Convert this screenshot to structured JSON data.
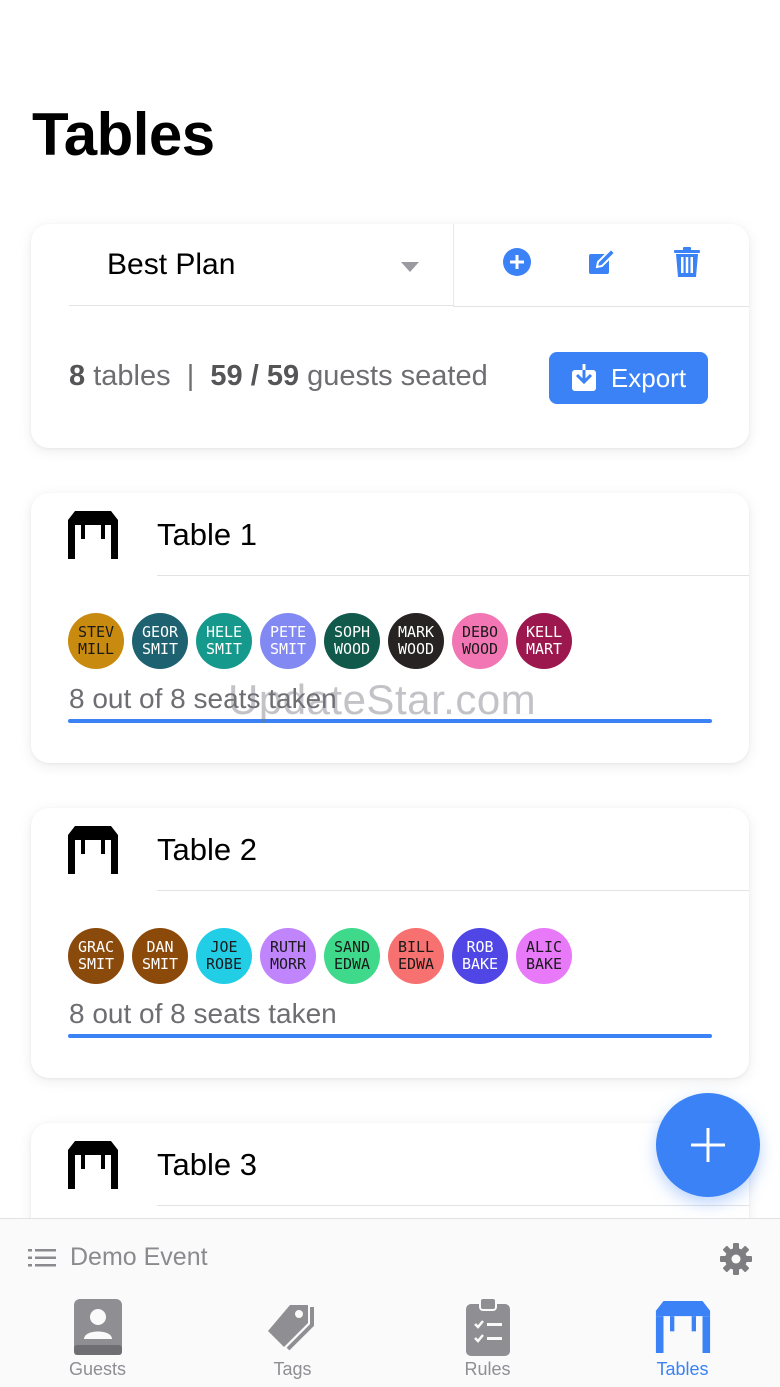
{
  "page": {
    "title": "Tables"
  },
  "plan": {
    "name": "Best Plan",
    "table_count": "8",
    "tables_label": "tables",
    "separator": "|",
    "guests_seated": "59 / 59",
    "guests_label": "guests seated",
    "export_label": "Export"
  },
  "tables": [
    {
      "name": "Table 1",
      "seats_text": "8 out of 8 seats taken",
      "progress": 1.0,
      "guests": [
        {
          "line1": "STEV",
          "line2": "MILL",
          "color": "#c98a10",
          "text": "dark"
        },
        {
          "line1": "GEOR",
          "line2": "SMIT",
          "color": "#1e6272",
          "text": "light"
        },
        {
          "line1": "HELE",
          "line2": "SMIT",
          "color": "#14998c",
          "text": "light"
        },
        {
          "line1": "PETE",
          "line2": "SMIT",
          "color": "#8389f2",
          "text": "light"
        },
        {
          "line1": "SOPH",
          "line2": "WOOD",
          "color": "#11594b",
          "text": "light"
        },
        {
          "line1": "MARK",
          "line2": "WOOD",
          "color": "#262322",
          "text": "light"
        },
        {
          "line1": "DEBO",
          "line2": "WOOD",
          "color": "#f276b4",
          "text": "dark"
        },
        {
          "line1": "KELL",
          "line2": "MART",
          "color": "#9c174d",
          "text": "light"
        }
      ]
    },
    {
      "name": "Table 2",
      "seats_text": "8 out of 8 seats taken",
      "progress": 1.0,
      "guests": [
        {
          "line1": "GRAC",
          "line2": "SMIT",
          "color": "#8a4a0c",
          "text": "light"
        },
        {
          "line1": "DAN",
          "line2": "SMIT",
          "color": "#8c4a0a",
          "text": "light"
        },
        {
          "line1": "JOE",
          "line2": "ROBE",
          "color": "#22cde6",
          "text": "dark"
        },
        {
          "line1": "RUTH",
          "line2": "MORR",
          "color": "#c084fc",
          "text": "dark"
        },
        {
          "line1": "SAND",
          "line2": "EDWA",
          "color": "#3ed98a",
          "text": "dark"
        },
        {
          "line1": "BILL",
          "line2": "EDWA",
          "color": "#f87171",
          "text": "dark"
        },
        {
          "line1": "ROB",
          "line2": "BAKE",
          "color": "#4f46e5",
          "text": "light"
        },
        {
          "line1": "ALIC",
          "line2": "BAKE",
          "color": "#e879f9",
          "text": "dark"
        }
      ]
    },
    {
      "name": "Table 3"
    }
  ],
  "watermark": "UpdateStar.com",
  "event": {
    "name": "Demo Event"
  },
  "tabs": [
    {
      "label": "Guests",
      "icon": "guests-icon"
    },
    {
      "label": "Tags",
      "icon": "tag-icon"
    },
    {
      "label": "Rules",
      "icon": "clipboard-icon"
    },
    {
      "label": "Tables",
      "icon": "table-icon",
      "active": true
    }
  ],
  "colors": {
    "accent": "#3b82f6",
    "inactive": "#8e8e93"
  }
}
